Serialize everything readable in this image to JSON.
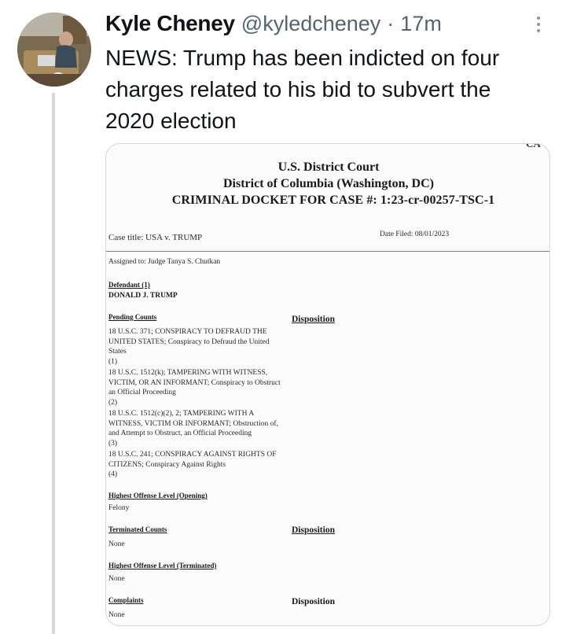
{
  "tweet": {
    "display_name": "Kyle Cheney",
    "handle": "@kyledcheney",
    "separator": "·",
    "timestamp": "17m",
    "text": "NEWS: Trump has been indicted on four charges related to his bid to subvert the 2020 election"
  },
  "document": {
    "corner_fragment": "CA",
    "court": "U.S. District Court",
    "district": "District of Columbia (Washington, DC)",
    "docket_title": "CRIMINAL DOCKET FOR CASE #: 1:23-cr-00257-TSC-1",
    "case_title": "Case title: USA v. TRUMP",
    "date_filed": "Date Filed: 08/01/2023",
    "assigned_to": "Assigned to: Judge Tanya S. Chutkan",
    "defendant_label": "Defendant (1)",
    "defendant_name": "DONALD J. TRUMP",
    "pending_counts_label": "Pending Counts",
    "disposition_label": "Disposition",
    "counts": [
      {
        "text": "18 U.S.C. 371; CONSPIRACY TO DEFRAUD THE UNITED STATES; Conspiracy to Defraud the United States",
        "number": "(1)"
      },
      {
        "text": "18 U.S.C. 1512(k); TAMPERING WITH WITNESS, VICTIM, OR AN INFORMANT; Conspiracy to Obstruct an Official Proceeding",
        "number": "(2)"
      },
      {
        "text": "18 U.S.C. 1512(c)(2), 2; TAMPERING WITH A WITNESS, VICTIM OR INFORMANT; Obstruction of, and Attempt to Obstruct, an Official Proceeding",
        "number": "(3)"
      },
      {
        "text": "18 U.S.C. 241; CONSPIRACY AGAINST RIGHTS OF CITIZENS; Conspiracy Against Rights",
        "number": "(4)"
      }
    ],
    "highest_opening_label": "Highest Offense Level (Opening)",
    "highest_opening_value": "Felony",
    "terminated_counts_label": "Terminated Counts",
    "terminated_counts_value": "None",
    "terminated_disposition_label": "Disposition",
    "highest_terminated_label": "Highest Offense Level (Terminated)",
    "highest_terminated_value": "None",
    "complaints_label": "Complaints",
    "complaints_value": "None",
    "complaints_disposition_label": "Disposition"
  }
}
